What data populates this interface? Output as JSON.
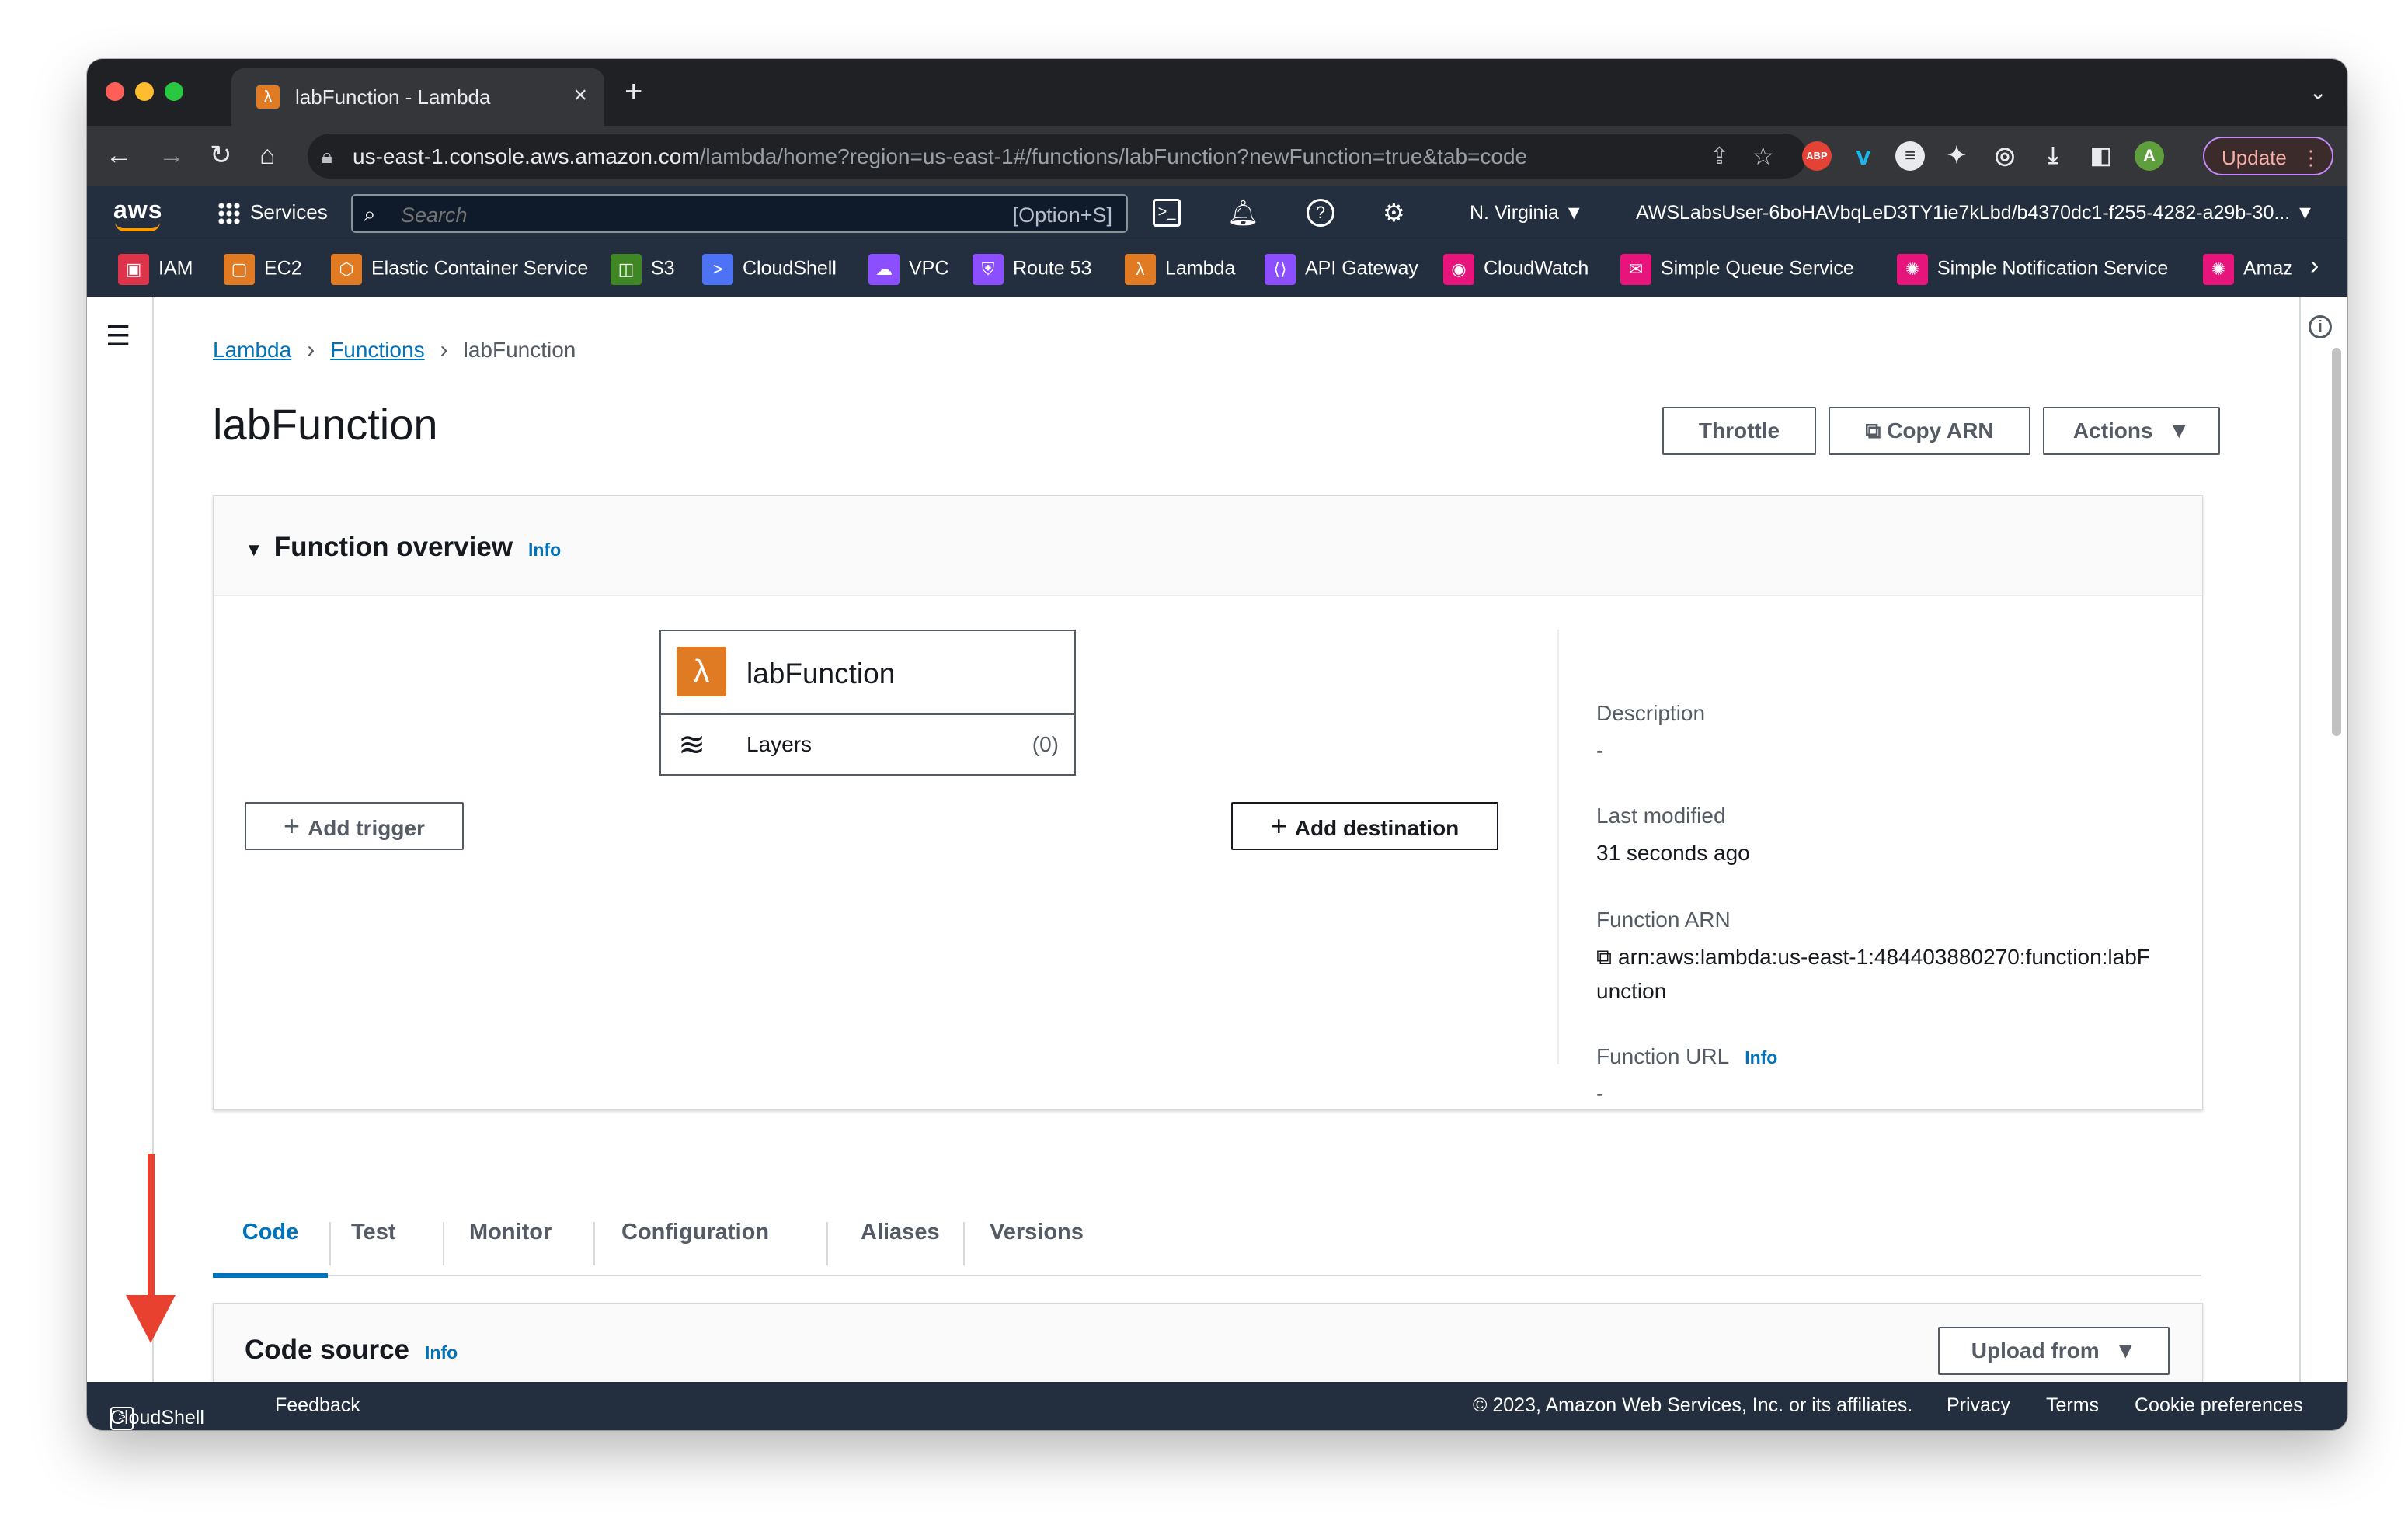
{
  "browser": {
    "tab_title": "labFunction - Lambda",
    "url_host": "us-east-1.console.aws.amazon.com",
    "url_path": "/lambda/home?region=us-east-1#/functions/labFunction?newFunction=true&tab=code",
    "update_label": "Update",
    "profile_initial": "A",
    "abp_label": "ABP"
  },
  "aws_nav": {
    "logo": "aws",
    "services_label": "Services",
    "search_placeholder": "Search",
    "search_shortcut": "[Option+S]",
    "region": "N. Virginia",
    "account": "AWSLabsUser-6boHAVbqLeD3TY1ie7kLbd/b4370dc1-f255-4282-a29b-30..."
  },
  "favorites": [
    {
      "label": "IAM",
      "color": "#dd344c"
    },
    {
      "label": "EC2",
      "color": "#e07b24"
    },
    {
      "label": "Elastic Container Service",
      "color": "#e07b24"
    },
    {
      "label": "S3",
      "color": "#3f8624"
    },
    {
      "label": "CloudShell",
      "color": "#4d72f3"
    },
    {
      "label": "VPC",
      "color": "#8c4fff"
    },
    {
      "label": "Route 53",
      "color": "#8c4fff"
    },
    {
      "label": "Lambda",
      "color": "#e07b24"
    },
    {
      "label": "API Gateway",
      "color": "#8c4fff"
    },
    {
      "label": "CloudWatch",
      "color": "#e7157b"
    },
    {
      "label": "Simple Queue Service",
      "color": "#e7157b"
    },
    {
      "label": "Simple Notification Service",
      "color": "#e7157b"
    },
    {
      "label": "Amaz",
      "color": "#e7157b"
    }
  ],
  "breadcrumb": {
    "lambda": "Lambda",
    "functions": "Functions",
    "current": "labFunction"
  },
  "page": {
    "title": "labFunction",
    "throttle_label": "Throttle",
    "copy_arn_label": "Copy ARN",
    "actions_label": "Actions"
  },
  "overview": {
    "title": "Function overview",
    "info": "Info",
    "function_name": "labFunction",
    "layers_label": "Layers",
    "layers_count": "(0)",
    "add_trigger": "Add trigger",
    "add_destination": "Add destination",
    "description_label": "Description",
    "description_value": "-",
    "last_modified_label": "Last modified",
    "last_modified_value": "31 seconds ago",
    "arn_label": "Function ARN",
    "arn_line1": "arn:aws:lambda:us-east-1:484403880270:function:labF",
    "arn_line2": "unction",
    "url_label": "Function URL",
    "url_info": "Info",
    "url_value": "-"
  },
  "tabs": [
    "Code",
    "Test",
    "Monitor",
    "Configuration",
    "Aliases",
    "Versions"
  ],
  "code_source": {
    "title": "Code source",
    "info": "Info",
    "upload_from": "Upload from"
  },
  "footer": {
    "cloudshell": "CloudShell",
    "feedback": "Feedback",
    "copyright": "© 2023, Amazon Web Services, Inc. or its affiliates.",
    "privacy": "Privacy",
    "terms": "Terms",
    "cookie": "Cookie preferences"
  },
  "accent_color": "#0073bb"
}
